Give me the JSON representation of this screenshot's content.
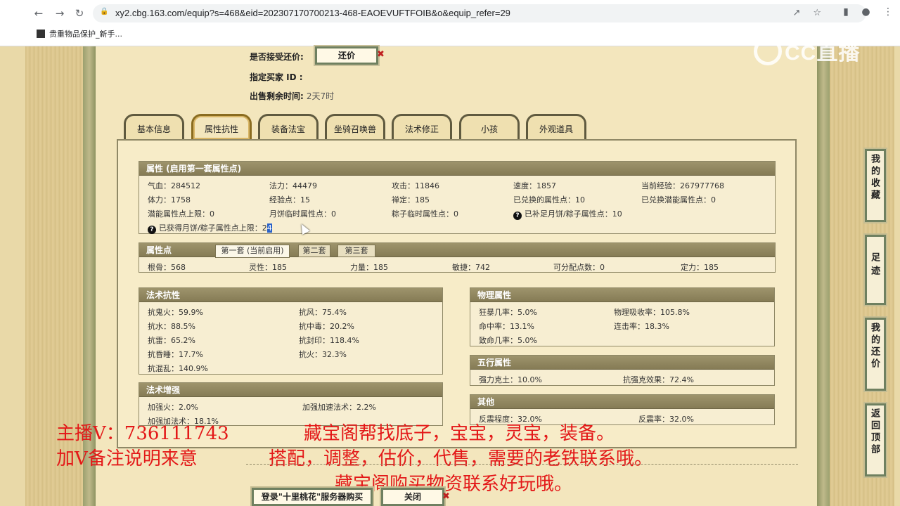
{
  "browser": {
    "url": "xy2.cbg.163.com/equip?s=468&eid=202307170700213-468-EAOEVUFTFOIB&o&equip_refer=29",
    "bookmark": "贵重物品保护_新手..."
  },
  "sale": {
    "accept_counter_label": "是否接受还价:",
    "counter_button": "还价",
    "buyer_label": "指定买家 ID :",
    "remaining_label": "出售剩余时间:",
    "remaining_value": "2天7时"
  },
  "tabs": [
    "基本信息",
    "属性抗性",
    "装备法宝",
    "坐骑召唤兽",
    "法术修正",
    "小孩",
    "外观道具"
  ],
  "attributes": {
    "title": "属性 (启用第一套属性点)",
    "rows": [
      [
        "气血：284512",
        "法力：44479",
        "攻击：11846",
        "速度：1857",
        "当前经验：267977768"
      ],
      [
        "体力：1758",
        "经验点：15",
        "禅定：185",
        "已兑换的属性点：10",
        "已兑换潜能属性点：0"
      ],
      [
        "潜能属性点上限：0",
        "月饼临时属性点：0",
        "粽子临时属性点：0",
        "已补足月饼/粽子属性点：10"
      ]
    ],
    "gained_label": "已获得月饼/粽子属性点上限：2",
    "gained_highlight": "4"
  },
  "points": {
    "title": "属性点",
    "subtabs": [
      "第一套 (当前启用)",
      "第二套",
      "第三套"
    ],
    "values": [
      "根骨：568",
      "灵性：185",
      "力量：185",
      "敏捷：742",
      "可分配点数：0",
      "定力：185"
    ]
  },
  "resist": {
    "title": "法术抗性",
    "items": [
      "抗鬼火：59.9%",
      "抗风：75.4%",
      "抗水：88.5%",
      "抗中毒：20.2%",
      "抗雷：65.2%",
      "抗封印：118.4%",
      "抗昏睡：17.7%",
      "抗火：32.3%",
      "抗混乱：140.9%"
    ]
  },
  "enhance": {
    "title": "法术增强",
    "items": [
      "加强火：2.0%",
      "加强加速法术：2.2%",
      "加强加法术：18.1%"
    ]
  },
  "physical": {
    "title": "物理属性",
    "items": [
      "狂暴几率：5.0%",
      "物理吸收率：105.8%",
      "命中率：13.1%",
      "连击率：18.3%",
      "致命几率：5.0%"
    ]
  },
  "five_elements": {
    "title": "五行属性",
    "items": [
      "强力克土：10.0%",
      "抗强克效果：72.4%"
    ]
  },
  "other": {
    "title": "其他",
    "items": [
      "反震程度：32.0%",
      "反震率：32.0%"
    ]
  },
  "side_buttons": [
    "我的收藏",
    "足迹",
    "我的还价",
    "返回顶部"
  ],
  "logo": "CC直播",
  "promo": {
    "line1_left": "主播V：736111743",
    "line1_right": "藏宝阁帮找底子，宝宝，灵宝，装备。",
    "line2_left": "加V备注说明来意",
    "line2_right": "搭配，调整，估价，代售，需要的老铁联系哦。",
    "line3": "藏宝阁购买物资联系好玩哦。"
  },
  "bottom": {
    "login_button": "登录\"十里桃花\"服务器购买",
    "close_button": "关闭"
  },
  "colors": {
    "promo": "#e31818",
    "header": "#8f8866",
    "counter_x": "#c02020"
  }
}
